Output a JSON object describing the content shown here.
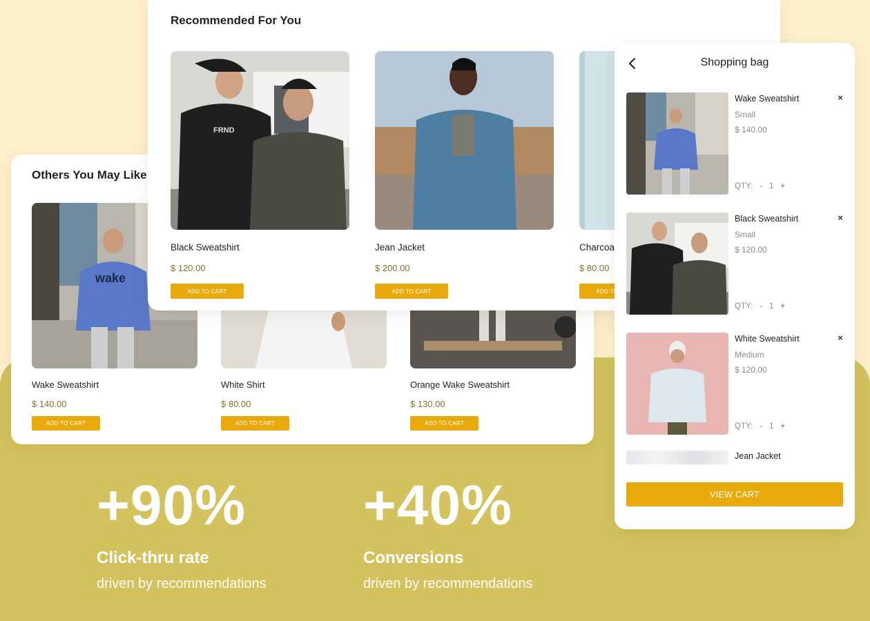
{
  "colors": {
    "background": "#fdf0cc",
    "band": "#d3c25e",
    "accent": "#eaaa0c",
    "price": "#8a6e2a"
  },
  "others": {
    "title": "Others You May Like",
    "products": [
      {
        "name": "Wake Sweatshirt",
        "price": "$ 140.00",
        "button": "ADD TO CART"
      },
      {
        "name": "White Shirt",
        "price": "$ 80.00",
        "button": "ADD TO CART"
      },
      {
        "name": "Orange Wake Sweatshirt",
        "price": "$ 130.00",
        "button": "ADD TO CART"
      }
    ]
  },
  "recommended": {
    "title": "Recommended For You",
    "products": [
      {
        "name": "Black Sweatshirt",
        "price": "$ 120.00",
        "button": "ADD TO CART"
      },
      {
        "name": "Jean Jacket",
        "price": "$ 200.00",
        "button": "ADD TO CART"
      },
      {
        "name": "Charcoa",
        "price": "$ 80.00",
        "button": "ADD TO CART"
      }
    ]
  },
  "bag": {
    "title": "Shopping bag",
    "qty_label": "QTY:",
    "minus": "-",
    "plus": "+",
    "remove": "×",
    "items": [
      {
        "name": "Wake Sweatshirt",
        "size": "Small",
        "price": "$ 140.00",
        "qty": "1"
      },
      {
        "name": "Black Sweatshirt",
        "size": "Small",
        "price": "$ 120.00",
        "qty": "1"
      },
      {
        "name": "White Sweatshirt",
        "size": "Medium",
        "price": "$ 120,00",
        "qty": "1"
      }
    ],
    "partial_item": "Jean Jacket",
    "view_cart": "VIEW CART"
  },
  "stats": [
    {
      "value": "+90%",
      "label": "Click-thru rate",
      "sub": "driven by recommendations"
    },
    {
      "value": "+40%",
      "label": "Conversions",
      "sub": "driven by recommendations"
    }
  ]
}
